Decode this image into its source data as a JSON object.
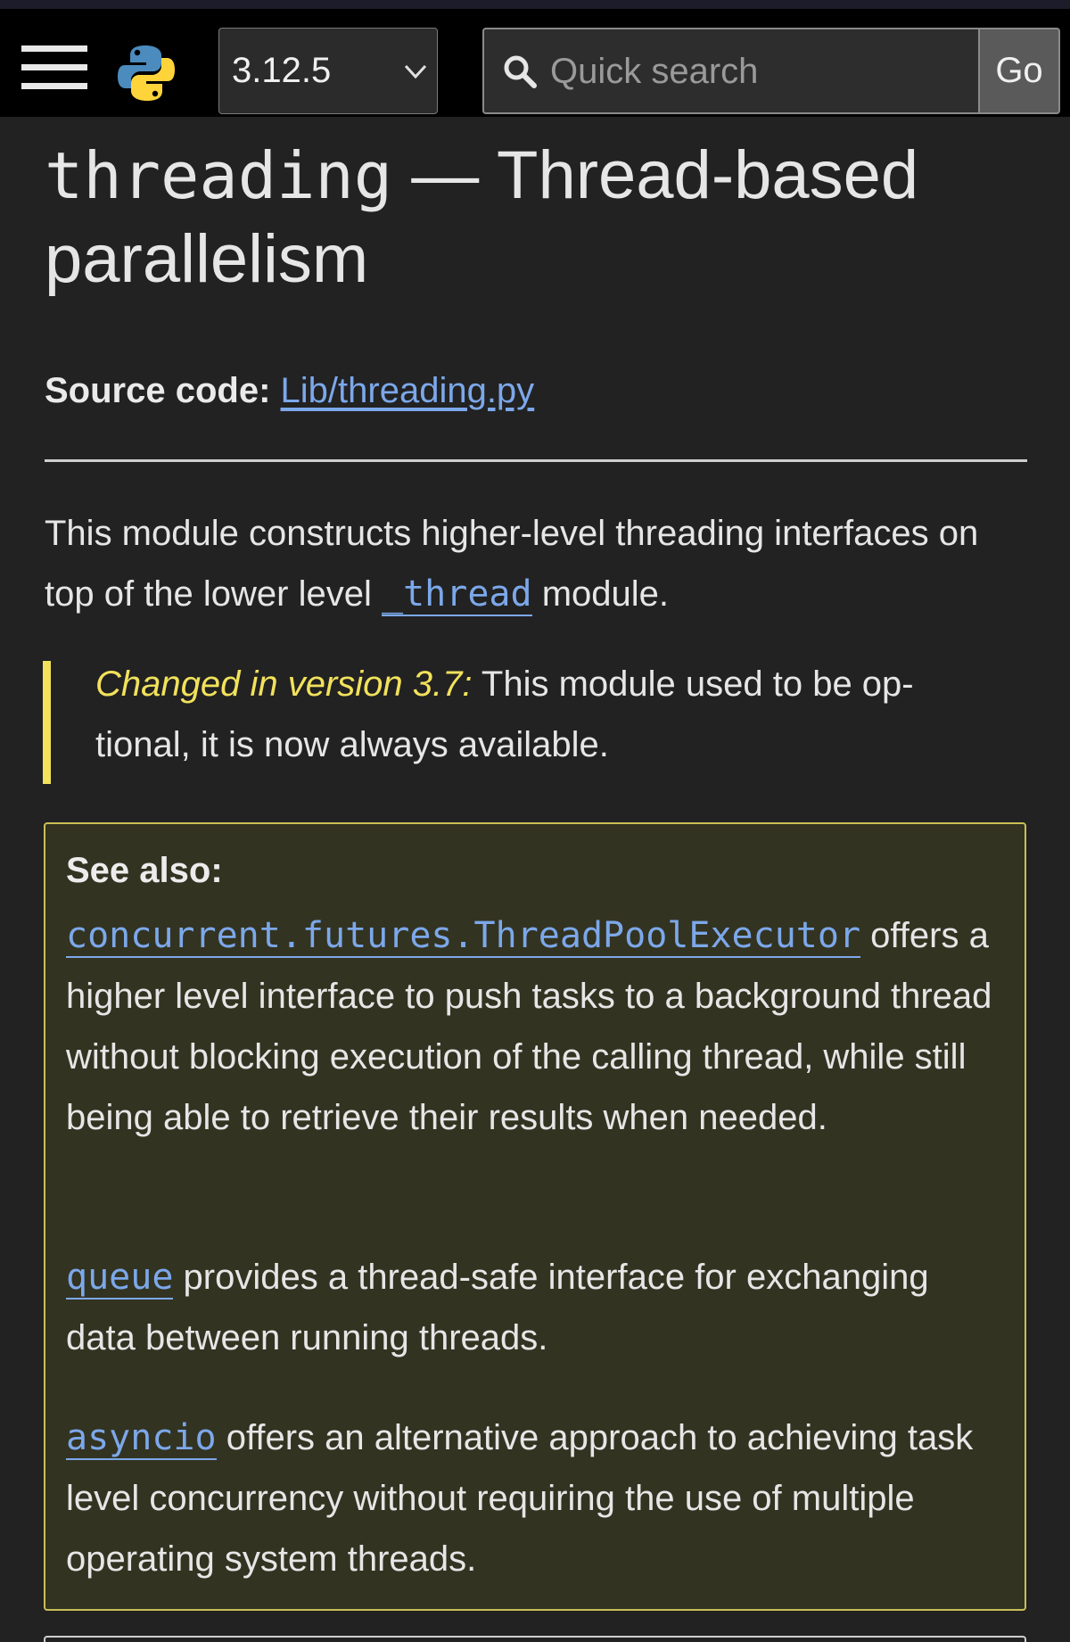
{
  "header": {
    "version": "3.12.5",
    "search_placeholder": "Quick search",
    "go_label": "Go",
    "icons": {
      "menu": "hamburger-menu-icon",
      "logo": "python-logo",
      "dropdown": "chevron-down-icon",
      "search": "magnifier-icon"
    }
  },
  "title": {
    "module": "threading",
    "dash": "—",
    "rest": "Thread-based parallelism"
  },
  "source": {
    "label": "Source code:",
    "link": "Lib/threading.py"
  },
  "intro": {
    "before": "This module constructs higher-level threading interfaces on top of the lower level ",
    "link": "_thread",
    "after": " module."
  },
  "version_changed": {
    "label": "Changed in version 3.7:",
    "text": " This module used to be op­tional, it is now always available."
  },
  "see_also": {
    "title": "See also:",
    "items": [
      {
        "link": "concurrent.futures.ThreadPoolExecutor",
        "text": " offers a higher level interface to push tasks to a background thread without blocking execution of the calling thread, while still being able to retrieve their results when needed."
      },
      {
        "link": "queue",
        "text": " provides a thread-safe interface for exchanging data between running threads."
      },
      {
        "link": "asyncio",
        "text": " offers an alternative approach to achieving task level concurrency without requiring the use of mul­tiple operating system threads."
      }
    ]
  },
  "colors": {
    "background": "#222222",
    "header": "#000000",
    "link": "#7ca8ea",
    "version_accent": "#f2e25c",
    "seealso_bg": "#333322",
    "seealso_border": "#c9bf58"
  }
}
